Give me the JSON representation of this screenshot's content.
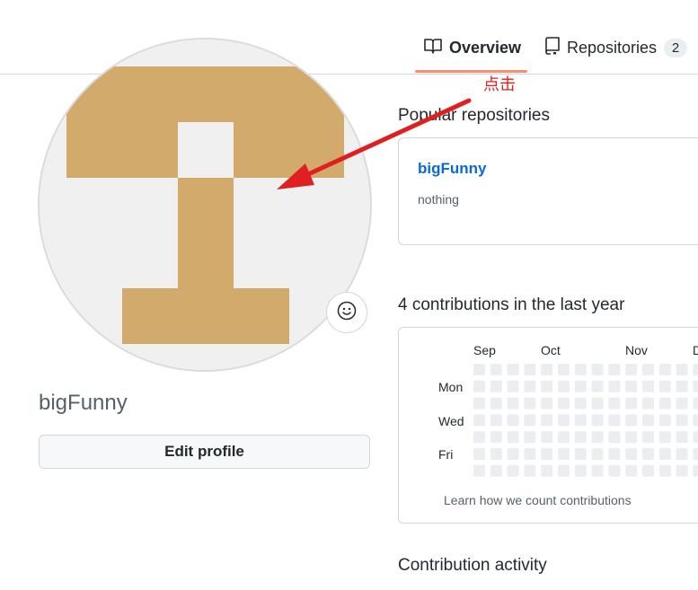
{
  "tabs": [
    {
      "label": "Overview",
      "icon": "book-icon"
    },
    {
      "label": "Repositories",
      "icon": "repo-icon",
      "count": "2"
    }
  ],
  "profile": {
    "username": "bigFunny",
    "edit_label": "Edit profile"
  },
  "popular": {
    "title": "Popular repositories",
    "repo_name": "bigFunny",
    "repo_desc": "nothing"
  },
  "contributions": {
    "title": "4 contributions in the last year",
    "months": [
      "Sep",
      "Oct",
      "Nov",
      "D"
    ],
    "days": [
      "Mon",
      "Wed",
      "Fri"
    ],
    "learn_link": "Learn how we count contributions"
  },
  "activity": {
    "title": "Contribution activity"
  },
  "annotation": {
    "text": "点击",
    "color": "#e02020"
  },
  "colors": {
    "accent": "#fd8c73",
    "link": "#0969da",
    "avatar": "#d2aa6b",
    "avatar_bg": "#f0f0f0",
    "cell_empty": "#ebedf0"
  }
}
